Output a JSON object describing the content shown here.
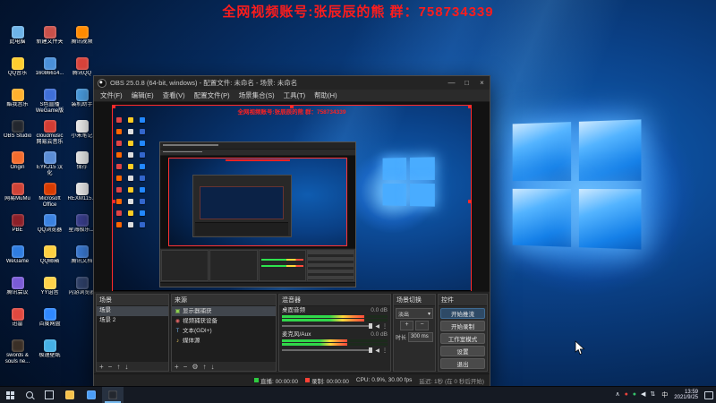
{
  "banner": {
    "text": "全网视频账号:张辰辰的熊 群：758734339",
    "color": "#ff1e1e"
  },
  "desktop": {
    "columns": [
      [
        {
          "label": "此电脑",
          "color": "#6db3e8"
        },
        {
          "label": "QQ音乐",
          "color": "#ffce2e"
        },
        {
          "label": "酷我音乐",
          "color": "#ffb02e"
        },
        {
          "label": "OBS Studio",
          "color": "#23272e"
        },
        {
          "label": "Origin",
          "color": "#f56c2d"
        },
        {
          "label": "网易MuMu",
          "color": "#cf4236"
        },
        {
          "label": "PBE",
          "color": "#8c1f28"
        },
        {
          "label": "WeGame",
          "color": "#2f7de1"
        },
        {
          "label": "腾讯会议",
          "color": "#7a5bd6"
        },
        {
          "label": "迅雷",
          "color": "#e0483f"
        },
        {
          "label": "swords & souls ne...",
          "color": "#3a2f26"
        }
      ],
      [
        {
          "label": "新建文件夹",
          "color": "#c9504a"
        },
        {
          "label": "16086614...",
          "color": "#4a90d9"
        },
        {
          "label": "S色直播 WeGame版",
          "color": "#3f6fd8"
        },
        {
          "label": "cloudmusic 网易云音乐",
          "color": "#d43c33"
        },
        {
          "label": "EYKJ15 汉化",
          "color": "#5b8dd6"
        },
        {
          "label": "Microsoft Office",
          "color": "#d83b01"
        },
        {
          "label": "QQ浏览器",
          "color": "#3b82e0"
        },
        {
          "label": "QQ邮箱",
          "color": "#ffd040"
        },
        {
          "label": "YY语音",
          "color": "#ffd24a"
        },
        {
          "label": "百度网盘",
          "color": "#2f88ff"
        },
        {
          "label": "极速壁纸",
          "color": "#45b0e5"
        }
      ],
      [
        {
          "label": "腾讯视频",
          "color": "#ff8a00"
        },
        {
          "label": "腾讯QQ",
          "color": "#d9433b"
        },
        {
          "label": "装机助手",
          "color": "#4a9de0"
        },
        {
          "label": "小米笔记",
          "color": "#f0f0f0"
        },
        {
          "label": "保存",
          "color": "#e9e9e9"
        },
        {
          "label": "REXM115...",
          "color": "#ececec"
        },
        {
          "label": "星海极乐二",
          "color": "#3a3f8f"
        },
        {
          "label": "腾讯文档",
          "color": "#3a7bd5"
        },
        {
          "label": "闪游浏览器",
          "color": "#30426b"
        }
      ]
    ]
  },
  "obs": {
    "title": "OBS 25.0.8 (64-bit, windows) - 配置文件: 未命名 - 场景: 未命名",
    "window_buttons": [
      {
        "name": "minimize-icon",
        "glyph": "—"
      },
      {
        "name": "maximize-icon",
        "glyph": "□"
      },
      {
        "name": "close-icon",
        "glyph": "×"
      }
    ],
    "menus": [
      "文件(F)",
      "编辑(E)",
      "查看(V)",
      "配置文件(P)",
      "场景集合(S)",
      "工具(T)",
      "帮助(H)"
    ],
    "scenes": {
      "title": "场景",
      "items": [
        "场景",
        "场景 2"
      ],
      "selected_index": 0,
      "toolbar": [
        {
          "name": "add-scene-icon",
          "glyph": "+"
        },
        {
          "name": "remove-scene-icon",
          "glyph": "−"
        },
        {
          "name": "scene-up-icon",
          "glyph": "↑"
        },
        {
          "name": "scene-down-icon",
          "glyph": "↓"
        }
      ]
    },
    "sources": {
      "title": "来源",
      "items": [
        {
          "icon": "monitor",
          "label": "显示器捕获",
          "color": "#8fd14f"
        },
        {
          "icon": "camera",
          "label": "视频捕获设备",
          "color": "#e06666"
        },
        {
          "icon": "text",
          "label": "文本(GDI+)",
          "color": "#6fa8dc"
        },
        {
          "icon": "media",
          "label": "媒体源",
          "color": "#ffd966"
        }
      ],
      "selected_index": 0,
      "toolbar": [
        {
          "name": "add-source-icon",
          "glyph": "+"
        },
        {
          "name": "remove-source-icon",
          "glyph": "−"
        },
        {
          "name": "source-properties-icon",
          "glyph": "⚙"
        },
        {
          "name": "source-up-icon",
          "glyph": "↑"
        },
        {
          "name": "source-down-icon",
          "glyph": "↓"
        }
      ]
    },
    "mixer": {
      "title": "混音器",
      "channels": [
        {
          "name": "桌面音频",
          "db": "0.0 dB",
          "level": 0.78
        },
        {
          "name": "麦克风/Aux",
          "db": "0.0 dB",
          "level": 0.62
        }
      ]
    },
    "transitions": {
      "title": "场景切换",
      "selected": "淡出",
      "caret": "▾",
      "add_glyph": "+",
      "remove_glyph": "−",
      "duration_label": "时长",
      "duration_value": "300 ms"
    },
    "controls": {
      "title": "控件",
      "buttons": [
        "开始推流",
        "开始录制",
        "工作室模式",
        "设置",
        "退出"
      ]
    },
    "status": {
      "live": "直播: 00:00:00",
      "rec": "录制: 00:00:00",
      "cpu": "CPU: 0.9%, 30.00 fps",
      "note": "延迟: 1秒 (在 0 秒后开始)"
    }
  },
  "taskbar": {
    "apps": [
      {
        "name": "file-explorer-icon",
        "color": "#f7c24a",
        "active": false
      },
      {
        "name": "browser-icon",
        "color": "#4a9df7",
        "active": false
      },
      {
        "name": "obs-taskbar-icon",
        "color": "#23272e",
        "active": true
      }
    ],
    "tray": [
      {
        "name": "tray-expand-icon",
        "glyph": "∧",
        "color": "#dfe6ee"
      },
      {
        "name": "tray-qq-icon",
        "glyph": "●",
        "color": "#e8433c"
      },
      {
        "name": "tray-green-icon",
        "glyph": "●",
        "color": "#35c06a"
      },
      {
        "name": "volume-icon",
        "glyph": "◀",
        "color": "#dfe6ee"
      },
      {
        "name": "network-icon",
        "glyph": "⇅",
        "color": "#dfe6ee"
      }
    ],
    "ime": "中",
    "time": "13:59",
    "date": "2021/9/25"
  }
}
